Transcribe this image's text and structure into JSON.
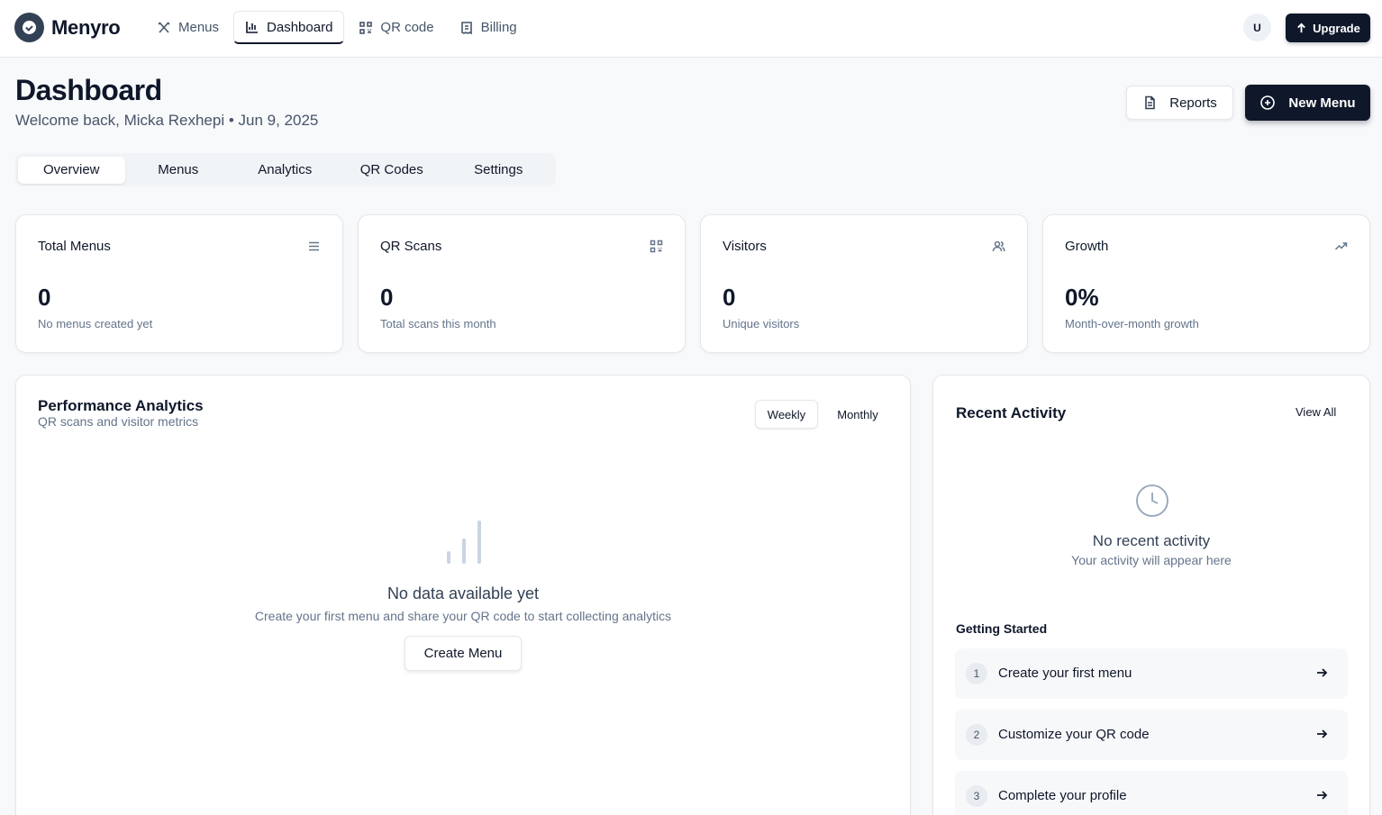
{
  "app": {
    "name": "Menyro"
  },
  "nav": {
    "items": [
      {
        "label": "Menus",
        "icon": "utensils-icon"
      },
      {
        "label": "Dashboard",
        "icon": "bar-chart-icon"
      },
      {
        "label": "QR code",
        "icon": "qr-code-icon"
      },
      {
        "label": "Billing",
        "icon": "receipt-icon"
      }
    ],
    "active": "Dashboard",
    "avatar_initial": "U",
    "upgrade_label": "Upgrade"
  },
  "header": {
    "title": "Dashboard",
    "subtitle": "Welcome back, Micka Rexhepi • Jun 9, 2025",
    "reports_label": "Reports",
    "new_menu_label": "New Menu"
  },
  "tabs": {
    "items": [
      "Overview",
      "Menus",
      "Analytics",
      "QR Codes",
      "Settings"
    ],
    "active": "Overview"
  },
  "stats": [
    {
      "label": "Total Menus",
      "value": "0",
      "desc": "No menus created yet",
      "icon": "list-icon"
    },
    {
      "label": "QR Scans",
      "value": "0",
      "desc": "Total scans this month",
      "icon": "qr-code-icon"
    },
    {
      "label": "Visitors",
      "value": "0",
      "desc": "Unique visitors",
      "icon": "users-icon"
    },
    {
      "label": "Growth",
      "value": "0%",
      "desc": "Month-over-month growth",
      "icon": "trending-up-icon"
    }
  ],
  "performance": {
    "title": "Performance Analytics",
    "subtitle": "QR scans and visitor metrics",
    "toggle": {
      "weekly": "Weekly",
      "monthly": "Monthly",
      "active": "Weekly"
    },
    "empty_title": "No data available yet",
    "empty_desc": "Create your first menu and share your QR code to start collecting analytics",
    "create_label": "Create Menu"
  },
  "activity": {
    "title": "Recent Activity",
    "view_all": "View All",
    "empty_title": "No recent activity",
    "empty_desc": "Your activity will appear here",
    "getting_started_title": "Getting Started",
    "steps": [
      {
        "num": "1",
        "label": "Create your first menu"
      },
      {
        "num": "2",
        "label": "Customize your QR code"
      },
      {
        "num": "3",
        "label": "Complete your profile"
      }
    ]
  },
  "colors": {
    "primary": "#0f172a",
    "muted": "#64748b",
    "border": "#e5e7eb",
    "background": "#f8f9fb"
  }
}
